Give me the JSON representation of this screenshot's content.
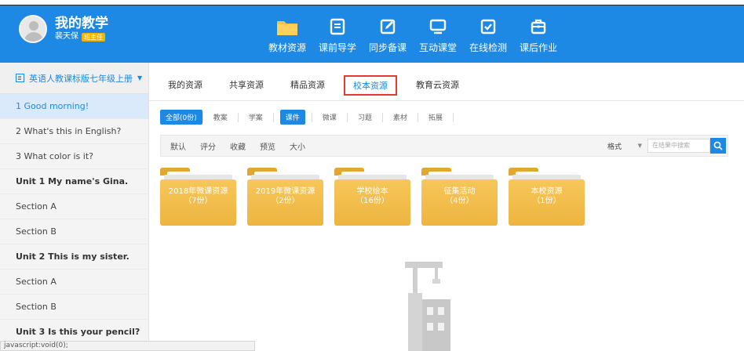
{
  "header": {
    "title": "我的教学",
    "user_name": "裴天保",
    "badge": "班主任"
  },
  "nav": [
    {
      "label": "教材资源",
      "icon": "folder-icon",
      "active": true
    },
    {
      "label": "课前导学",
      "icon": "document-icon"
    },
    {
      "label": "同步备课",
      "icon": "edit-icon"
    },
    {
      "label": "互动课堂",
      "icon": "monitor-icon"
    },
    {
      "label": "在线检测",
      "icon": "checkbox-icon"
    },
    {
      "label": "课后作业",
      "icon": "briefcase-icon"
    }
  ],
  "sidebar": {
    "book": "英语人教课标版七年级上册",
    "items": [
      {
        "label": "1 Good morning!",
        "type": "lesson",
        "active": true
      },
      {
        "label": "2 What's this in English?",
        "type": "lesson"
      },
      {
        "label": "3 What color is it?",
        "type": "lesson"
      },
      {
        "label": "Unit 1 My name's Gina.",
        "type": "unit"
      },
      {
        "label": "Section A",
        "type": "lesson"
      },
      {
        "label": "Section B",
        "type": "lesson"
      },
      {
        "label": "Unit 2 This is my sister.",
        "type": "unit"
      },
      {
        "label": "Section A",
        "type": "lesson"
      },
      {
        "label": "Section B",
        "type": "lesson"
      },
      {
        "label": "Unit 3 Is this your pencil?",
        "type": "unit"
      }
    ]
  },
  "tabs": [
    {
      "label": "我的资源"
    },
    {
      "label": "共享资源"
    },
    {
      "label": "精品资源"
    },
    {
      "label": "校本资源",
      "selected": true
    },
    {
      "label": "教育云资源"
    }
  ],
  "filters": [
    {
      "label": "全部(0份)",
      "selected": true
    },
    {
      "label": "教案"
    },
    {
      "label": "学案"
    },
    {
      "label": "课件",
      "selected": true
    },
    {
      "label": "微课"
    },
    {
      "label": "习题"
    },
    {
      "label": "素材"
    },
    {
      "label": "拓展"
    }
  ],
  "sort": {
    "options": [
      "默认",
      "评分",
      "收藏",
      "预览",
      "大小"
    ],
    "format_label": "格式",
    "search_placeholder": "在结果中搜索"
  },
  "folders": [
    {
      "name": "2018年微课资源",
      "count": "（7份）"
    },
    {
      "name": "2019年微课资源",
      "count": "（2份）"
    },
    {
      "name": "学校绘本",
      "count": "（16份）"
    },
    {
      "name": "征集活动",
      "count": "（4份）"
    },
    {
      "name": "本校资源",
      "count": "（1份）"
    }
  ],
  "status_bar": "javascript:void(0);",
  "colors": {
    "primary": "#1e88e5",
    "folder": "#f3bd4d",
    "highlight_border": "#e53935"
  }
}
